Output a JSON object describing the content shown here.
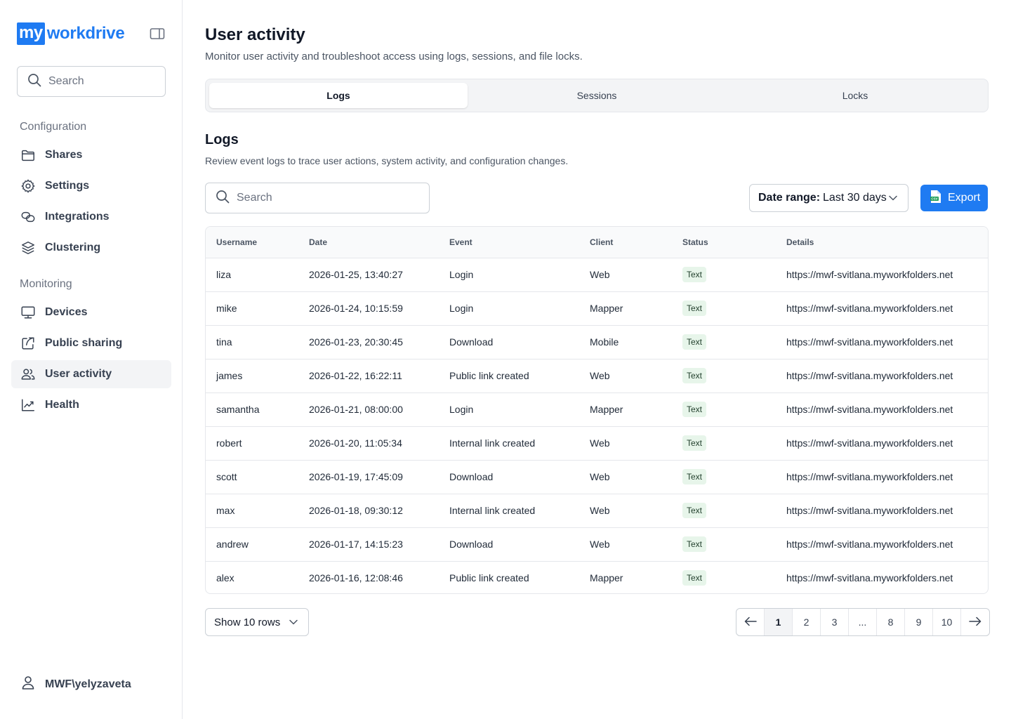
{
  "brand": {
    "logo_prefix": "my",
    "logo_name": "workdrive",
    "accent": "#1f7bf2"
  },
  "sidebar": {
    "search_placeholder": "Search",
    "sections": {
      "configuration": "Configuration",
      "monitoring": "Monitoring"
    },
    "items": [
      {
        "label": "Shares",
        "icon": "folder-icon"
      },
      {
        "label": "Settings",
        "icon": "gear-icon"
      },
      {
        "label": "Integrations",
        "icon": "link-icon"
      },
      {
        "label": "Clustering",
        "icon": "layers-icon"
      },
      {
        "label": "Devices",
        "icon": "monitor-icon"
      },
      {
        "label": "Public sharing",
        "icon": "share-icon"
      },
      {
        "label": "User activity",
        "icon": "users-icon",
        "active": true
      },
      {
        "label": "Health",
        "icon": "trend-icon"
      }
    ],
    "user": "MWF\\yelyzaveta"
  },
  "page": {
    "title": "User activity",
    "subtitle": "Monitor user activity and troubleshoot access using logs, sessions, and file locks.",
    "tabs": [
      "Logs",
      "Sessions",
      "Locks"
    ],
    "active_tab": "Logs"
  },
  "logs": {
    "title": "Logs",
    "subtitle": "Review event logs to trace user actions, system activity, and configuration changes.",
    "search_placeholder": "Search",
    "date_range_label": "Date range:",
    "date_range_value": "Last 30 days",
    "export_label": "Export",
    "columns": [
      "Username",
      "Date",
      "Event",
      "Client",
      "Status",
      "Details"
    ],
    "rows": [
      [
        "liza",
        "2026-01-25, 13:40:27",
        "Login",
        "Web",
        "Text",
        "https://mwf-svitlana.myworkfolders.net"
      ],
      [
        "mike",
        "2026-01-24, 10:15:59",
        "Login",
        "Mapper",
        "Text",
        "https://mwf-svitlana.myworkfolders.net"
      ],
      [
        "tina",
        "2026-01-23, 20:30:45",
        "Download",
        "Mobile",
        "Text",
        "https://mwf-svitlana.myworkfolders.net"
      ],
      [
        "james",
        "2026-01-22, 16:22:11",
        "Public link created",
        "Web",
        "Text",
        "https://mwf-svitlana.myworkfolders.net"
      ],
      [
        "samantha",
        "2026-01-21, 08:00:00",
        "Login",
        "Mapper",
        "Text",
        "https://mwf-svitlana.myworkfolders.net"
      ],
      [
        "robert",
        "2026-01-20, 11:05:34",
        "Internal link created",
        "Web",
        "Text",
        "https://mwf-svitlana.myworkfolders.net"
      ],
      [
        "scott",
        "2026-01-19, 17:45:09",
        "Download",
        "Web",
        "Text",
        "https://mwf-svitlana.myworkfolders.net"
      ],
      [
        "max",
        "2026-01-18, 09:30:12",
        "Internal link created",
        "Web",
        "Text",
        "https://mwf-svitlana.myworkfolders.net"
      ],
      [
        "andrew",
        "2026-01-17, 14:15:23",
        "Download",
        "Web",
        "Text",
        "https://mwf-svitlana.myworkfolders.net"
      ],
      [
        "alex",
        "2026-01-16, 12:08:46",
        "Public link created",
        "Mapper",
        "Text",
        "https://mwf-svitlana.myworkfolders.net"
      ]
    ],
    "rows_select": "Show 10 rows",
    "pagination": [
      "1",
      "2",
      "3",
      "...",
      "8",
      "9",
      "10"
    ],
    "current_page": "1"
  }
}
